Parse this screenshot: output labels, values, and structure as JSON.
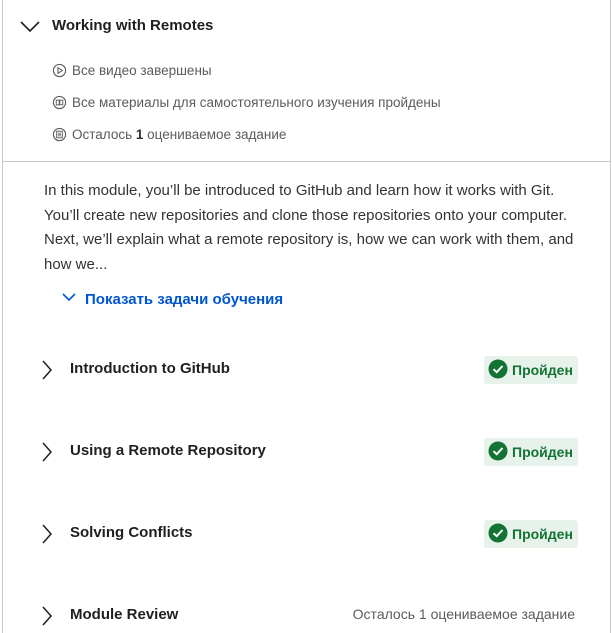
{
  "module": {
    "title": "Working with Remotes",
    "stats": [
      {
        "icon": "play-circle-icon",
        "text": "Все видео завершены"
      },
      {
        "icon": "book-icon",
        "text": "Все материалы для самостоятельного изучения пройдены"
      },
      {
        "icon": "assignment-icon",
        "prefix": "Осталось ",
        "count": "1",
        "suffix": " оцениваемое задание"
      }
    ],
    "description": "In this module, you’ll be introduced to GitHub and learn how it works with Git. You’ll create new repositories and clone those repositories onto your computer. Next, we’ll explain what a remote repository is, how we can work with them, and how we...",
    "show_objectives_label": "Показать задачи обучения"
  },
  "lessons": [
    {
      "name": "Introduction to GitHub",
      "status": "Пройден"
    },
    {
      "name": "Using a Remote Repository",
      "status": "Пройден"
    },
    {
      "name": "Solving Conflicts",
      "status": "Пройден"
    },
    {
      "name": "Module Review",
      "remaining": "Осталось 1 оцениваемое задание"
    }
  ],
  "colors": {
    "link": "#0056d2",
    "success_text": "#137333",
    "success_bg": "#e7f2ea",
    "border": "#c9c9c9"
  }
}
